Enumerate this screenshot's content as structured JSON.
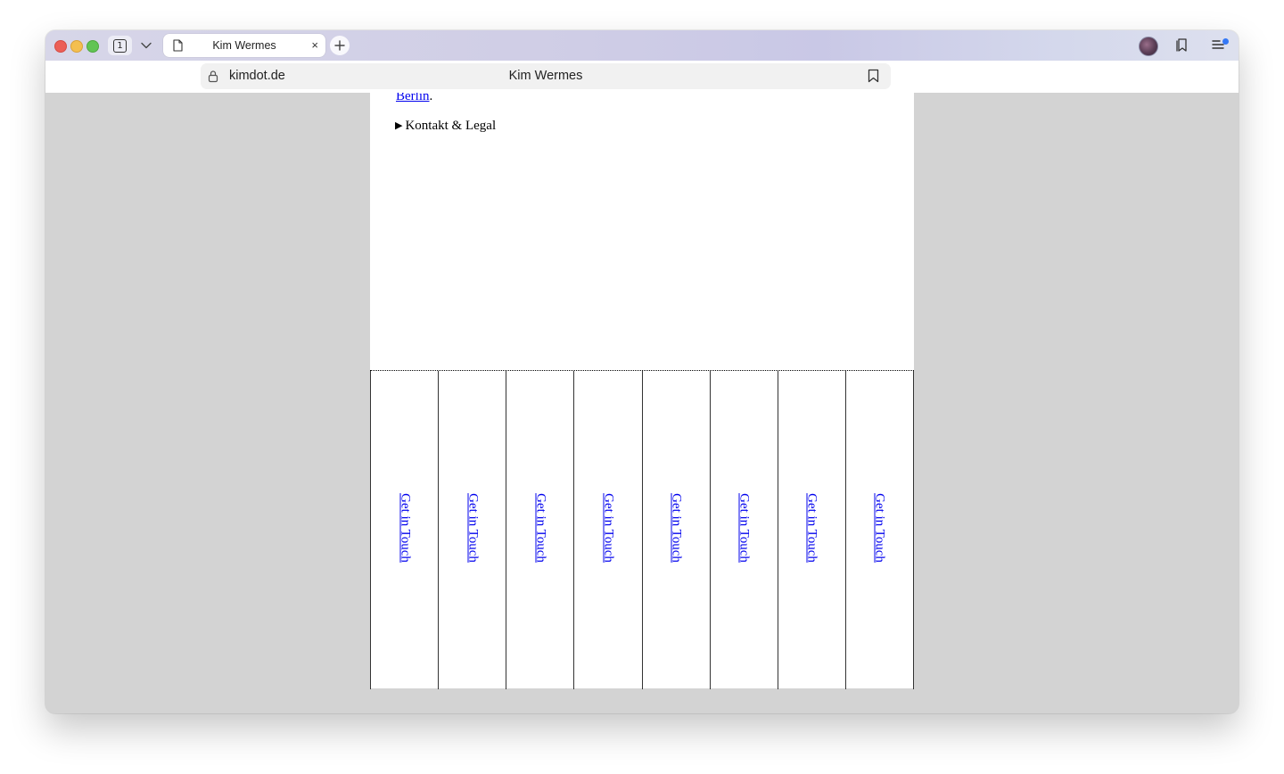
{
  "browser": {
    "tab_count": "1",
    "tab_title": "Kim Wermes",
    "tab_close": "×",
    "url": "kimdot.de",
    "page_title": "Kim Wermes"
  },
  "page": {
    "partial_link": "Berlin",
    "partial_after": ".",
    "details_marker": "▶",
    "details_summary": "Kontakt & Legal",
    "strips": [
      {
        "link": "Get in Touch"
      },
      {
        "link": "Get in Touch"
      },
      {
        "link": "Get in Touch"
      },
      {
        "link": "Get in Touch"
      },
      {
        "link": "Get in Touch"
      },
      {
        "link": "Get in Touch"
      },
      {
        "link": "Get in Touch"
      },
      {
        "link": "Get in Touch"
      }
    ]
  },
  "colors": {
    "link": "#0000ee",
    "page_background": "#d3d3d3",
    "content_background": "#ffffff",
    "sidebar_badge": "#3478f6"
  }
}
